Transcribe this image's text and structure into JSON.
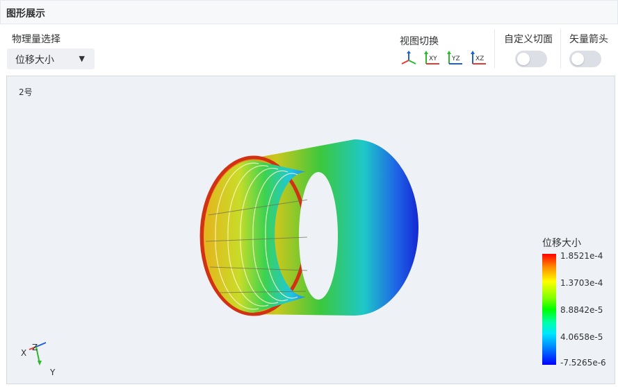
{
  "panel": {
    "title": "图形展示"
  },
  "quantity": {
    "label": "物理量选择",
    "selected": "位移大小"
  },
  "views": {
    "label": "视图切换",
    "buttons": [
      {
        "icon": "axes-3d-icon"
      },
      {
        "icon": "xy-view-icon",
        "text": "XY"
      },
      {
        "icon": "yz-view-icon",
        "text": "YZ"
      },
      {
        "icon": "xz-view-icon",
        "text": "XZ"
      }
    ]
  },
  "custom_section": {
    "label": "自定义切面",
    "enabled": false
  },
  "vector_arrows": {
    "label": "矢量箭头",
    "enabled": false
  },
  "viewport": {
    "part_label": "2号",
    "legend": {
      "title": "位移大小",
      "ticks": [
        "1.8521e-4",
        "1.3703e-4",
        "8.8842e-5",
        "4.0658e-5",
        "-7.5265e-6"
      ]
    },
    "axes": {
      "x": "X",
      "y": "Y",
      "z": "Z"
    }
  },
  "colors": {
    "accent_red": "#e53935",
    "axis_green": "#2eb82e",
    "axis_blue": "#1f5fd6"
  }
}
